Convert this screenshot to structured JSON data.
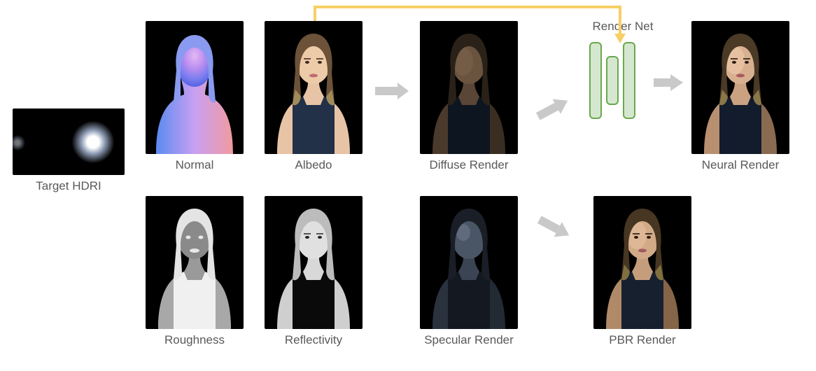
{
  "labels": {
    "target_hdri": "Target HDRI",
    "normal": "Normal",
    "albedo": "Albedo",
    "diffuse": "Diffuse Render",
    "roughness": "Roughness",
    "reflectivity": "Reflectivity",
    "specular": "Specular Render",
    "render_net": "Render Net",
    "neural_render": "Neural Render",
    "pbr_render": "PBR Render"
  },
  "colors": {
    "arrow_gray": "#c9c9c9",
    "arrow_yellow": "#f6cf65",
    "net_fill": "#d5e8cf",
    "net_stroke": "#6ba84f"
  }
}
